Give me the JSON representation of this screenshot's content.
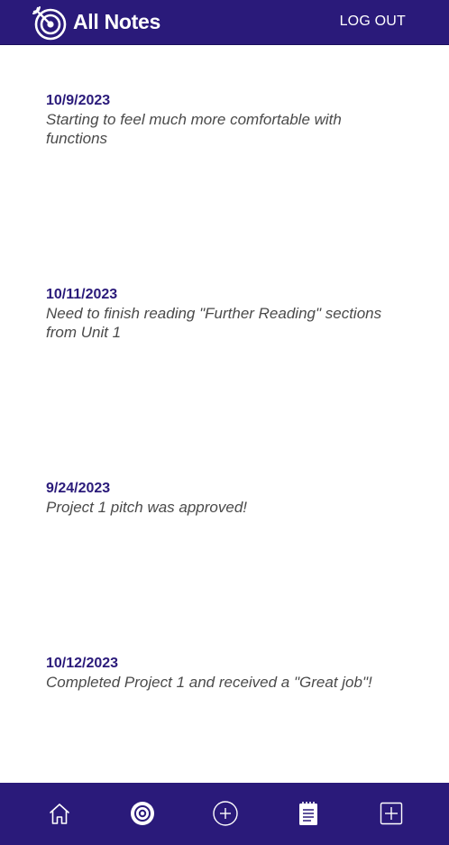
{
  "header": {
    "logo_icon": "target-icon",
    "title": "All Notes",
    "logout_label": "LOG OUT"
  },
  "notes": [
    {
      "date": "10/9/2023",
      "text": "Starting to feel much more comfortable with functions"
    },
    {
      "date": "10/11/2023",
      "text": "Need to finish reading \"Further Reading\" sections from Unit 1"
    },
    {
      "date": "9/24/2023",
      "text": "Project 1 pitch was approved!"
    },
    {
      "date": "10/12/2023",
      "text": "Completed Project 1 and received a \"Great job\"!"
    }
  ],
  "bottom_nav": {
    "items": [
      {
        "icon": "home-icon"
      },
      {
        "icon": "target-icon",
        "active": true
      },
      {
        "icon": "add-circle-icon"
      },
      {
        "icon": "notepad-icon"
      },
      {
        "icon": "add-square-icon"
      }
    ]
  },
  "colors": {
    "brand": "#2a1a7a",
    "date_text": "#2a1a7a",
    "note_text": "#4a4a4a",
    "background": "#ffffff"
  }
}
